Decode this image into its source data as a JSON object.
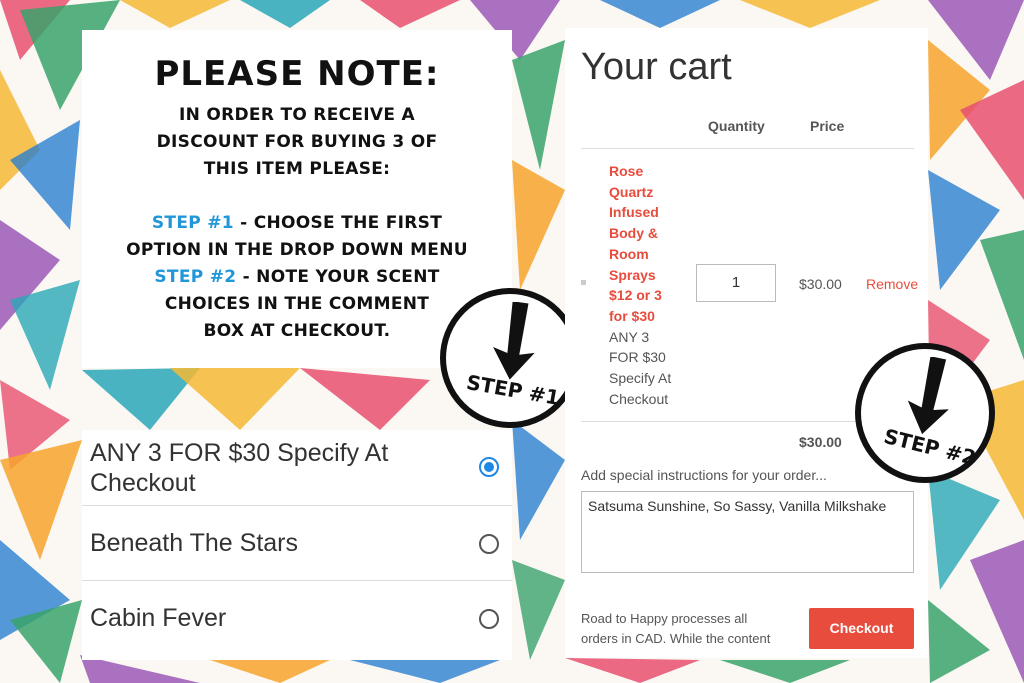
{
  "note": {
    "title": "Please note:",
    "line1": "In order to receive a",
    "line2": "discount for buying 3 of",
    "line3": "this item please:",
    "step1_label": "Step #1",
    "step1_text": " - Choose the first",
    "step1_line2": "option in the drop down menu",
    "step2_label": "Step #2",
    "step2_text": " - Note your scent",
    "step2_line2": "choices in the comment",
    "step2_line3": "box at checkout."
  },
  "badges": {
    "step1": "STEP #1",
    "step2": "STEP #2"
  },
  "options": [
    {
      "label_line1": "ANY 3 FOR $30 Specify At",
      "label_line2": "Checkout",
      "selected": true
    },
    {
      "label": "Beneath The Stars",
      "selected": false
    },
    {
      "label": "Cabin Fever",
      "selected": false
    }
  ],
  "cart": {
    "title": "Your cart",
    "col_quantity": "Quantity",
    "col_price": "Price",
    "item": {
      "name_lines": [
        "Rose",
        "Quartz",
        "Infused",
        "Body &",
        "Room",
        "Sprays",
        "$12 or 3",
        "for $30"
      ],
      "variant_lines": [
        "ANY 3",
        "FOR $30",
        "Specify At",
        "Checkout"
      ],
      "quantity": "1",
      "price": "$30.00",
      "remove_label": "Remove"
    },
    "subtotal": "$30.00",
    "instructions_label": "Add special instructions for your order...",
    "instructions_value": "Satsuma Sunshine, So Sassy, Vanilla Milkshake",
    "footer_line1": "Road to Happy processes all",
    "footer_line2": "orders in CAD. While the content",
    "checkout_label": "Checkout"
  },
  "colors": {
    "accent_red": "#e84c3d",
    "step_blue": "#2196d8",
    "radio_blue": "#1e88e5"
  }
}
